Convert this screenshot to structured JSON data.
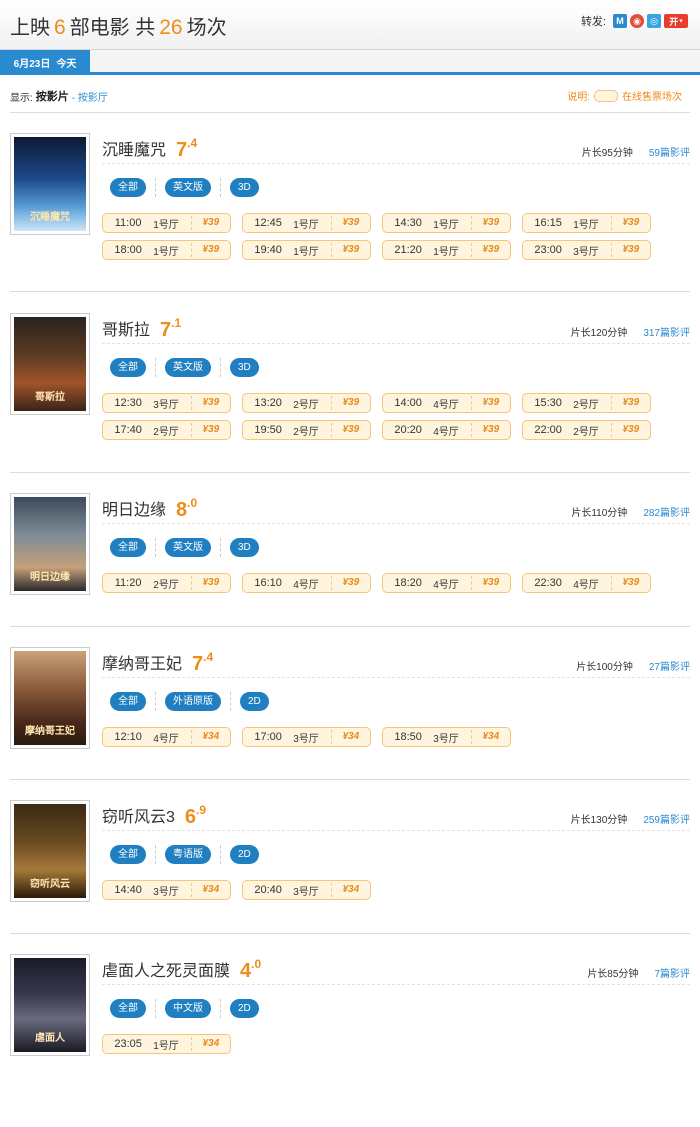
{
  "header": {
    "title_pre": "上映",
    "movie_count": "6",
    "title_mid": "部电影 共",
    "session_count": "26",
    "title_post": "场次",
    "share_label": "转发:",
    "share_icons": [
      "renren-icon",
      "weibo-icon",
      "qq-weibo-icon",
      "kaixin-icon"
    ],
    "share_icon_glyphs": [
      "M",
      "◉",
      "◎",
      "开"
    ]
  },
  "date_tab": {
    "date": "6月23日",
    "day": "今天"
  },
  "filter": {
    "label": "显示:",
    "active": "按影片",
    "separator": "-",
    "other": "按影厅"
  },
  "legend": {
    "label": "说明:",
    "text": "在线售票场次"
  },
  "colors": {
    "accent": "#2a8ad0",
    "score": "#f08c1a",
    "session_bg": "#fff5de",
    "session_border": "#f5c67a"
  },
  "movies": [
    {
      "name": "沉睡魔咒",
      "score_int": "7",
      "score_dec": ".4",
      "duration": "片长95分钟",
      "reviews": "59篇影评",
      "poster_text": "沉睡魔咒",
      "tags": [
        "全部",
        "英文版",
        "3D"
      ],
      "sessions": [
        {
          "time": "11:00",
          "hall": "1号厅",
          "price": "¥39"
        },
        {
          "time": "12:45",
          "hall": "1号厅",
          "price": "¥39"
        },
        {
          "time": "14:30",
          "hall": "1号厅",
          "price": "¥39"
        },
        {
          "time": "16:15",
          "hall": "1号厅",
          "price": "¥39"
        },
        {
          "time": "18:00",
          "hall": "1号厅",
          "price": "¥39"
        },
        {
          "time": "19:40",
          "hall": "1号厅",
          "price": "¥39"
        },
        {
          "time": "21:20",
          "hall": "1号厅",
          "price": "¥39"
        },
        {
          "time": "23:00",
          "hall": "3号厅",
          "price": "¥39"
        }
      ]
    },
    {
      "name": "哥斯拉",
      "score_int": "7",
      "score_dec": ".1",
      "duration": "片长120分钟",
      "reviews": "317篇影评",
      "poster_text": "哥斯拉",
      "tags": [
        "全部",
        "英文版",
        "3D"
      ],
      "sessions": [
        {
          "time": "12:30",
          "hall": "3号厅",
          "price": "¥39"
        },
        {
          "time": "13:20",
          "hall": "2号厅",
          "price": "¥39"
        },
        {
          "time": "14:00",
          "hall": "4号厅",
          "price": "¥39"
        },
        {
          "time": "15:30",
          "hall": "2号厅",
          "price": "¥39"
        },
        {
          "time": "17:40",
          "hall": "2号厅",
          "price": "¥39"
        },
        {
          "time": "19:50",
          "hall": "2号厅",
          "price": "¥39"
        },
        {
          "time": "20:20",
          "hall": "4号厅",
          "price": "¥39"
        },
        {
          "time": "22:00",
          "hall": "2号厅",
          "price": "¥39"
        }
      ]
    },
    {
      "name": "明日边缘",
      "score_int": "8",
      "score_dec": ".0",
      "duration": "片长110分钟",
      "reviews": "282篇影评",
      "poster_text": "明日边缘",
      "tags": [
        "全部",
        "英文版",
        "3D"
      ],
      "sessions": [
        {
          "time": "11:20",
          "hall": "2号厅",
          "price": "¥39"
        },
        {
          "time": "16:10",
          "hall": "4号厅",
          "price": "¥39"
        },
        {
          "time": "18:20",
          "hall": "4号厅",
          "price": "¥39"
        },
        {
          "time": "22:30",
          "hall": "4号厅",
          "price": "¥39"
        }
      ]
    },
    {
      "name": "摩纳哥王妃",
      "score_int": "7",
      "score_dec": ".4",
      "duration": "片长100分钟",
      "reviews": "27篇影评",
      "poster_text": "摩纳哥王妃",
      "tags": [
        "全部",
        "外语原版",
        "2D"
      ],
      "sessions": [
        {
          "time": "12:10",
          "hall": "4号厅",
          "price": "¥34"
        },
        {
          "time": "17:00",
          "hall": "3号厅",
          "price": "¥34"
        },
        {
          "time": "18:50",
          "hall": "3号厅",
          "price": "¥34"
        }
      ]
    },
    {
      "name": "窃听风云3",
      "score_int": "6",
      "score_dec": ".9",
      "duration": "片长130分钟",
      "reviews": "259篇影评",
      "poster_text": "窃听风云",
      "tags": [
        "全部",
        "粤语版",
        "2D"
      ],
      "sessions": [
        {
          "time": "14:40",
          "hall": "3号厅",
          "price": "¥34"
        },
        {
          "time": "20:40",
          "hall": "3号厅",
          "price": "¥34"
        }
      ]
    },
    {
      "name": "虐面人之死灵面膜",
      "score_int": "4",
      "score_dec": ".0",
      "duration": "片长85分钟",
      "reviews": "7篇影评",
      "poster_text": "虐面人",
      "tags": [
        "全部",
        "中文版",
        "2D"
      ],
      "sessions": [
        {
          "time": "23:05",
          "hall": "1号厅",
          "price": "¥34"
        }
      ]
    }
  ]
}
